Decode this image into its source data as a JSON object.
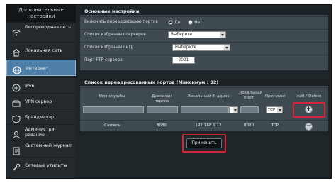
{
  "sidebar": {
    "header": "Дополнительные настройки",
    "items": [
      {
        "label": "Беспроводная сеть",
        "icon": "wifi-icon"
      },
      {
        "label": "Локальная сеть",
        "icon": "home-icon"
      },
      {
        "label": "Интернет",
        "icon": "globe-icon"
      },
      {
        "label": "IPv6",
        "icon": "ipv6-icon"
      },
      {
        "label": "VPN сервер",
        "icon": "vpn-icon"
      },
      {
        "label": "Брандмауэр",
        "icon": "firewall-icon"
      },
      {
        "label": "Администри-рование",
        "icon": "admin-icon"
      },
      {
        "label": "Системный журнал",
        "icon": "log-icon"
      },
      {
        "label": "Сетевые утилиты",
        "icon": "tools-icon"
      }
    ],
    "active_index": 2
  },
  "basic": {
    "title": "Основные настройки",
    "enable_label": "Включить переадресацию портов",
    "yes_label": "Да",
    "no_label": "Нет",
    "selected": "Нет",
    "servers_label": "Список избранных серверов",
    "servers_value": "Выберите",
    "games_label": "Список избранных игр",
    "games_value": "Выберите",
    "ftp_label": "Порт FTP-сервера",
    "ftp_value": "2021"
  },
  "forward": {
    "title": "Список переадресованных портов (Максимум : 32)",
    "headers": {
      "service": "Имя службы",
      "ports": "Диапазон портов",
      "ip": "Локальный IP-адрес",
      "local_port": "Локальный порт",
      "protocol": "Протокол",
      "actions": "Add / Delete"
    },
    "input_protocol": "TCP",
    "add_symbol": "+",
    "delete_symbol": "−",
    "rows": [
      {
        "service": "Camera",
        "ports": "8080",
        "ip": "192.168.1.12",
        "local_port": "8080",
        "protocol": "TCP"
      }
    ]
  },
  "apply_label": "Применить",
  "colors": {
    "accent": "#4d7fa8",
    "highlight": "#d4263b"
  }
}
